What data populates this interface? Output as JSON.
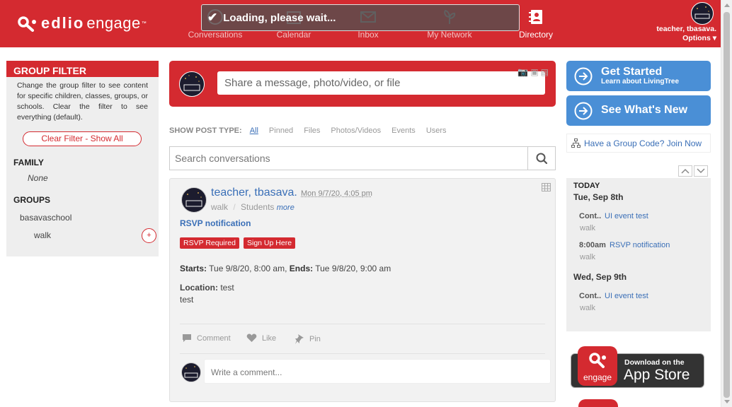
{
  "app": {
    "brand_edlio": "edlio",
    "brand_engage": "engage",
    "brand_tm": "™"
  },
  "nav": [
    {
      "label": "Conversations",
      "icon": "conversations-icon"
    },
    {
      "label": "Calendar",
      "icon": "calendar-icon"
    },
    {
      "label": "Inbox",
      "icon": "inbox-icon"
    },
    {
      "label": "My Network",
      "icon": "network-icon"
    },
    {
      "label": "Directory",
      "icon": "directory-icon"
    }
  ],
  "loading": {
    "text": "Loading, please wait..."
  },
  "user": {
    "name": "teacher, tbasava.",
    "options": "Options ▾"
  },
  "filter": {
    "heading": "GROUP FILTER",
    "description": "Change the group filter to see content for specific children, classes, groups, or schools. Clear the filter to see everything (default).",
    "clear_label": "Clear Filter - Show All",
    "family_heading": "FAMILY",
    "family_value": "None",
    "groups_heading": "GROUPS",
    "groups": [
      "basavaschool",
      "walk"
    ],
    "plus": "+"
  },
  "composer": {
    "placeholder": "Share a message, photo/video, or file"
  },
  "post_type": {
    "label": "SHOW POST TYPE:",
    "options": [
      "All",
      "Pinned",
      "Files",
      "Photos/Videos",
      "Events",
      "Users"
    ]
  },
  "search": {
    "placeholder": "Search conversations"
  },
  "post": {
    "author": "teacher, tbasava.",
    "date": "Mon 9/7/20, 4:05 pm",
    "group": "walk",
    "separator": "/",
    "audience": "Students",
    "more": "more",
    "title": "RSVP notification",
    "badges": [
      "RSVP Required",
      "Sign Up Here"
    ],
    "starts_label": "Starts:",
    "starts_value": "Tue 9/8/20, 8:00 am,",
    "ends_label": "Ends:",
    "ends_value": "Tue 9/8/20, 9:00 am",
    "location_label": "Location:",
    "location_value": "test",
    "location_detail": "test",
    "actions": [
      "Comment",
      "Like",
      "Pin"
    ],
    "comment_placeholder": "Write a comment..."
  },
  "right": {
    "get_started_title": "Get Started",
    "get_started_sub": "Learn about LivingTree",
    "whats_new_title": "See What's New",
    "group_code": "Have a Group Code? Join Now"
  },
  "calendar": {
    "today": "TODAY",
    "days": [
      {
        "date": "Tue, Sep 8th",
        "events": [
          {
            "time": "Cont..",
            "title": "UI event test",
            "group": "walk"
          },
          {
            "time": "8:00am",
            "title": "RSVP notification",
            "group": "walk"
          }
        ]
      },
      {
        "date": "Wed, Sep 9th",
        "events": [
          {
            "time": "Cont..",
            "title": "UI event test",
            "group": "walk"
          }
        ]
      }
    ]
  },
  "appstore": {
    "download": "Download on the",
    "store": "App Store",
    "engage": "engage"
  },
  "colors": {
    "brand_red": "#d42a30",
    "link_blue": "#3a6fb7",
    "cta_blue": "#4a8fd6"
  }
}
